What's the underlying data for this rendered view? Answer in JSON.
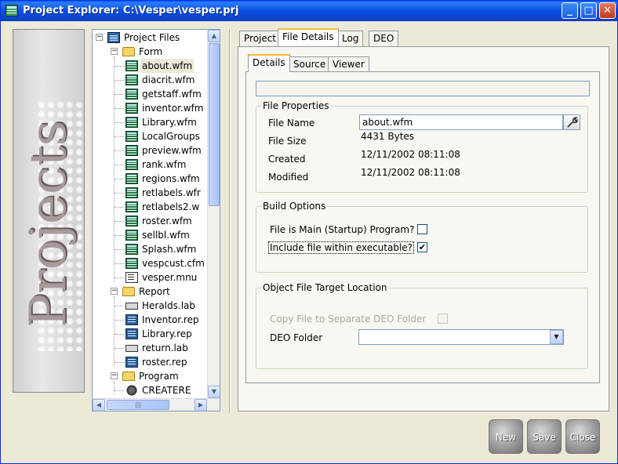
{
  "window": {
    "title": "Project Explorer: C:\\Vesper\\vesper.prj",
    "controls": {
      "minimize": "_",
      "maximize": "□",
      "close": "✕"
    }
  },
  "branding": {
    "text": "Projects"
  },
  "tree": {
    "root": {
      "label": "Project Files",
      "expander": "−"
    },
    "groups": [
      {
        "label": "Form",
        "expander": "−",
        "items": [
          {
            "label": "about.wfm",
            "icon": "wfm-icon",
            "selected": true
          },
          {
            "label": "diacrit.wfm",
            "icon": "wfm-icon"
          },
          {
            "label": "getstaff.wfm",
            "icon": "wfm-icon"
          },
          {
            "label": "inventor.wfm",
            "icon": "wfm-icon"
          },
          {
            "label": "Library.wfm",
            "icon": "wfm-icon"
          },
          {
            "label": "LocalGroups",
            "icon": "wfm-icon"
          },
          {
            "label": "preview.wfm",
            "icon": "wfm-icon"
          },
          {
            "label": "rank.wfm",
            "icon": "wfm-icon"
          },
          {
            "label": "regions.wfm",
            "icon": "wfm-icon"
          },
          {
            "label": "retlabels.wfr",
            "icon": "wfm-icon"
          },
          {
            "label": "retlabels2.w",
            "icon": "wfm-icon"
          },
          {
            "label": "roster.wfm",
            "icon": "wfm-icon"
          },
          {
            "label": "sellbl.wfm",
            "icon": "wfm-icon"
          },
          {
            "label": "Splash.wfm",
            "icon": "wfm-icon"
          },
          {
            "label": "vespcust.cfm",
            "icon": "wfm-icon"
          },
          {
            "label": "vesper.mnu",
            "icon": "mnu-icon"
          }
        ]
      },
      {
        "label": "Report",
        "expander": "−",
        "items": [
          {
            "label": "Heralds.lab",
            "icon": "lab-icon"
          },
          {
            "label": "Inventor.rep",
            "icon": "rep-icon"
          },
          {
            "label": "Library.rep",
            "icon": "rep-icon"
          },
          {
            "label": "return.lab",
            "icon": "lab-icon"
          },
          {
            "label": "roster.rep",
            "icon": "rep-icon"
          }
        ]
      },
      {
        "label": "Program",
        "expander": "−",
        "items": [
          {
            "label": "CREATERE",
            "icon": "prg-icon"
          }
        ]
      }
    ],
    "scroll": {
      "up": "▲",
      "down": "▼",
      "left": "◀",
      "right": "▶",
      "grip": "≡",
      "hgrip": "|||"
    }
  },
  "tabs": {
    "main": [
      {
        "label": "Project",
        "active": false
      },
      {
        "label": "File Details",
        "active": true
      },
      {
        "label": "Log",
        "active": false
      },
      {
        "label": "DEO",
        "active": false
      }
    ],
    "sub": [
      {
        "label": "Details",
        "active": true
      },
      {
        "label": "Source",
        "active": false
      },
      {
        "label": "Viewer",
        "active": false
      }
    ]
  },
  "details": {
    "path_value": "",
    "file_properties": {
      "legend": "File Properties",
      "file_name_label": "File Name",
      "file_name_value": "about.wfm",
      "file_size_label": "File Size",
      "file_size_value": "4431 Bytes",
      "created_label": "Created",
      "created_value": "12/11/2002 08:11:08",
      "modified_label": "Modified",
      "modified_value": "12/11/2002 08:11:08"
    },
    "build_options": {
      "legend": "Build Options",
      "main_program_label": "File is Main (Startup) Program?",
      "main_program_checked": false,
      "include_label": "Include file within executable?",
      "include_checked": true,
      "check_mark": "✔"
    },
    "object_target": {
      "legend": "Object File Target Location",
      "copy_label": "Copy File to Separate DEO Folder",
      "copy_checked": false,
      "deo_folder_label": "DEO Folder",
      "deo_folder_value": "",
      "dropdown_arrow": "▼"
    }
  },
  "buttons": {
    "new": "New",
    "save": "Save",
    "close": "Close"
  }
}
